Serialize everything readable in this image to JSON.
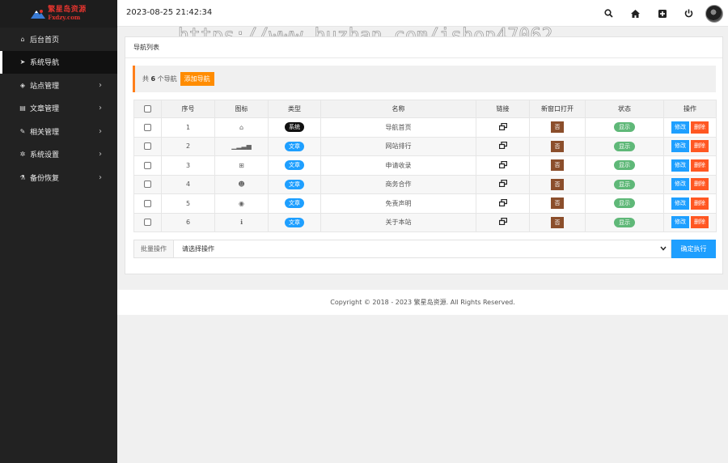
{
  "brand": {
    "name_cn": "繁星岛资源",
    "name_en": "Fxdzy.com"
  },
  "sidebar": {
    "items": [
      {
        "label": "后台首页",
        "icon": "home-icon",
        "glyph": "⌂",
        "has_arrow": false,
        "active": false
      },
      {
        "label": "系统导航",
        "icon": "send-icon",
        "glyph": "➤",
        "has_arrow": false,
        "active": true
      },
      {
        "label": "站点管理",
        "icon": "cube-icon",
        "glyph": "◈",
        "has_arrow": true,
        "active": false
      },
      {
        "label": "文章管理",
        "icon": "book-icon",
        "glyph": "▤",
        "has_arrow": true,
        "active": false
      },
      {
        "label": "相关管理",
        "icon": "wrench-icon",
        "glyph": "✎",
        "has_arrow": true,
        "active": false
      },
      {
        "label": "系统设置",
        "icon": "gear-icon",
        "glyph": "✲",
        "has_arrow": true,
        "active": false
      },
      {
        "label": "备份恢复",
        "icon": "flask-icon",
        "glyph": "⚗",
        "has_arrow": true,
        "active": false
      }
    ],
    "arrow_glyph": "›"
  },
  "header": {
    "datetime": "2023-08-25 21:42:34",
    "icons": [
      "search-icon",
      "home-icon",
      "plus-square-icon",
      "power-icon"
    ]
  },
  "watermark": "https://www.huzhan.com/ishop47062",
  "panel": {
    "title": "导航列表",
    "count_prefix": "共 ",
    "count": "6",
    "count_suffix": " 个导航",
    "add_button": "添加导航"
  },
  "table": {
    "headers": [
      "序号",
      "图标",
      "类型",
      "名称",
      "链接",
      "新窗口打开",
      "状态",
      "操作"
    ],
    "rows": [
      {
        "no": "1",
        "icon": "home-icon",
        "glyph": "⌂",
        "type": "系统",
        "type_kind": "sys",
        "name": "导航首页",
        "new_window": "否",
        "status": "显示"
      },
      {
        "no": "2",
        "icon": "signal-icon",
        "glyph": "▁▂▃▅",
        "type": "文章",
        "type_kind": "art",
        "name": "网站排行",
        "new_window": "否",
        "status": "显示"
      },
      {
        "no": "3",
        "icon": "plus-square-icon",
        "glyph": "⊞",
        "type": "文章",
        "type_kind": "art",
        "name": "申请收录",
        "new_window": "否",
        "status": "显示"
      },
      {
        "no": "4",
        "icon": "users-icon",
        "glyph": "☻",
        "type": "文章",
        "type_kind": "art",
        "name": "商务合作",
        "new_window": "否",
        "status": "显示"
      },
      {
        "no": "5",
        "icon": "eye-icon",
        "glyph": "◉",
        "type": "文章",
        "type_kind": "art",
        "name": "免责声明",
        "new_window": "否",
        "status": "显示"
      },
      {
        "no": "6",
        "icon": "info-icon",
        "glyph": "ℹ",
        "type": "文章",
        "type_kind": "art",
        "name": "关于本站",
        "new_window": "否",
        "status": "显示"
      }
    ],
    "edit_label": "修改",
    "delete_label": "删除"
  },
  "batch": {
    "label": "批量操作",
    "select_value": "请选择操作",
    "submit": "确定执行"
  },
  "footer": "Copyright © 2018 - 2023 繁星岛资源. All Rights Reserved.",
  "colors": {
    "sidebar_bg": "#222222",
    "accent_orange": "#ff8c00",
    "primary_blue": "#1e9fff",
    "danger": "#ff5722",
    "success": "#5fb878",
    "brown": "#8b4e2b"
  }
}
